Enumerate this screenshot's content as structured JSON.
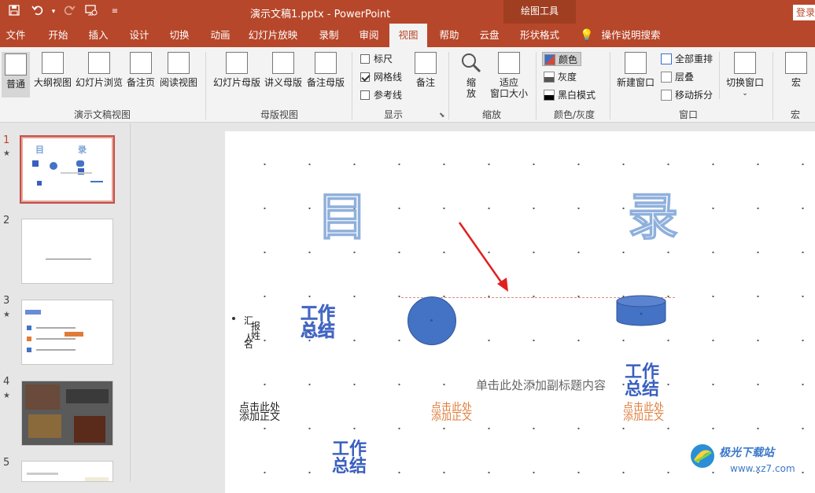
{
  "app": {
    "doc_title": "演示文稿1.pptx - PowerPoint",
    "contextual_tab_group": "绘图工具",
    "login_label": "登录"
  },
  "qat": {
    "save_icon": "save-icon",
    "undo_icon": "undo-icon",
    "redo_icon": "redo-icon",
    "present_icon": "present-from-start-icon",
    "customize_icon": "customize-qat-icon"
  },
  "tabs": [
    {
      "label": "文件"
    },
    {
      "label": "开始"
    },
    {
      "label": "插入"
    },
    {
      "label": "设计"
    },
    {
      "label": "切换"
    },
    {
      "label": "动画"
    },
    {
      "label": "幻灯片放映"
    },
    {
      "label": "录制"
    },
    {
      "label": "审阅"
    },
    {
      "label": "视图"
    },
    {
      "label": "帮助"
    },
    {
      "label": "云盘"
    },
    {
      "label": "形状格式"
    }
  ],
  "tell_me": "操作说明搜索",
  "ribbon": {
    "presentation_views": {
      "label": "演示文稿视图",
      "buttons": [
        "普通",
        "大纲视图",
        "幻灯片浏览",
        "备注页",
        "阅读视图"
      ]
    },
    "master_views": {
      "label": "母版视图",
      "buttons": [
        "幻灯片母版",
        "讲义母版",
        "备注母版"
      ]
    },
    "show": {
      "label": "显示",
      "ruler": "标尺",
      "gridlines": "网格线",
      "guides": "参考线",
      "notes": "备注"
    },
    "zoom": {
      "label": "缩放",
      "zoom_btn": [
        "缩",
        "放"
      ],
      "fit_btn": [
        "适应",
        "窗口大小"
      ]
    },
    "color": {
      "label": "颜色/灰度",
      "color": "颜色",
      "grayscale": "灰度",
      "bw": "黑白模式"
    },
    "window": {
      "label": "窗口",
      "new_window": "新建窗口",
      "arrange_all": "全部重排",
      "cascade": "层叠",
      "move_split": "移动拆分",
      "switch_windows": "切换窗口"
    },
    "macros": {
      "label": "宏",
      "button": "宏"
    }
  },
  "slides": [
    {
      "num": "1",
      "star": true
    },
    {
      "num": "2",
      "star": false
    },
    {
      "num": "3",
      "star": true
    },
    {
      "num": "4",
      "star": true
    },
    {
      "num": "5",
      "star": false
    }
  ],
  "slide": {
    "title_char_1": "目",
    "title_char_2": "录",
    "wordart_1": [
      "工作",
      "总结"
    ],
    "wordart_2": [
      "工作",
      "总结"
    ],
    "wordart_3": [
      "工作",
      "总结"
    ],
    "vertical_text": [
      "汇",
      "报",
      "人",
      "姓",
      "名"
    ],
    "subtitle_placeholder": "单击此处添加副标题内容",
    "click_text": [
      "点击此处",
      "添加正文"
    ],
    "click_text_orange_1": [
      "点击此处",
      "添加正文"
    ],
    "click_text_orange_2": [
      "点击此处",
      "添加正文"
    ]
  },
  "watermark": {
    "text": "极光下载站",
    "url": "www.xz7.com"
  },
  "colors": {
    "brand": "#b7472a",
    "shape_blue": "#4472c4",
    "arrow_red": "#e02020",
    "orange_text": "#e07b39"
  }
}
